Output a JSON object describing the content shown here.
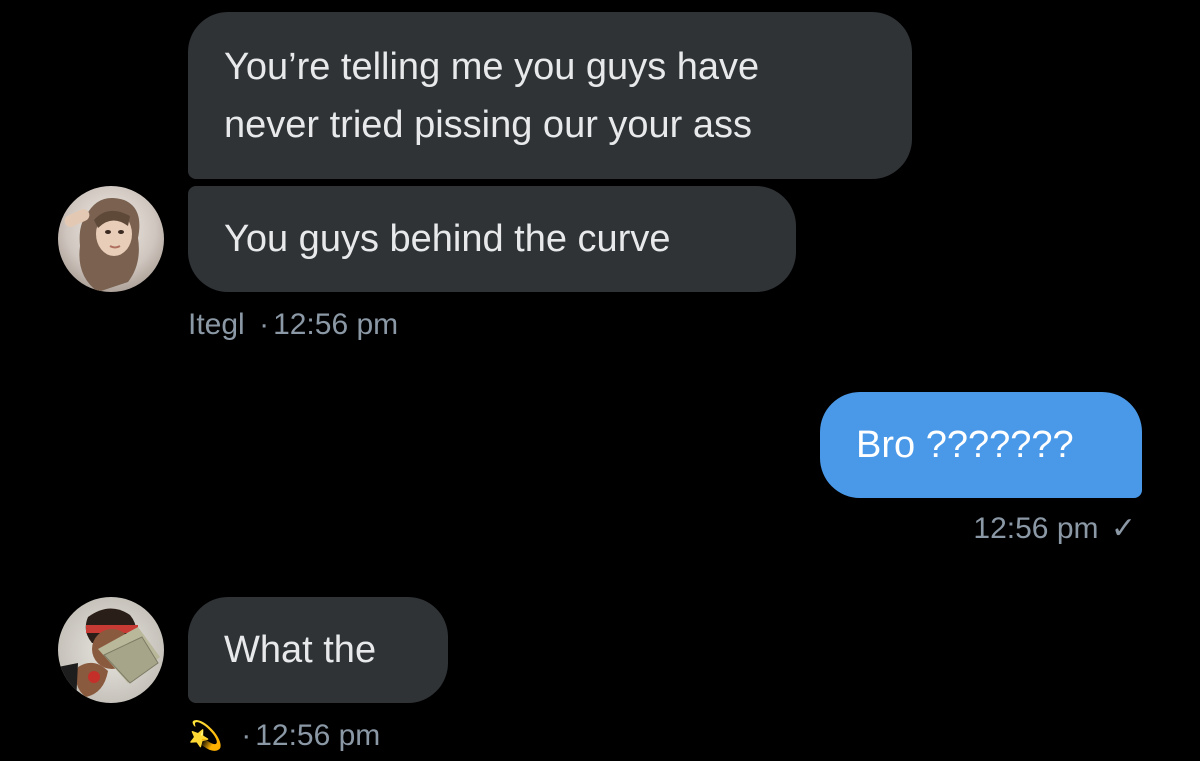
{
  "conversation": {
    "group1": {
      "messages": [
        {
          "text_line1": "You’re telling me you guys have",
          "text_line2": "never tried pissing our your ass"
        },
        {
          "text": "You guys behind the curve"
        }
      ],
      "sender_name": "Itegl",
      "separator": "·",
      "time": "12:56 pm",
      "avatar_icon": "user-avatar-photo"
    },
    "sent": {
      "text": "Bro ???????",
      "time": "12:56 pm",
      "status_icon": "checkmark-icon",
      "status_glyph": "✓"
    },
    "group2": {
      "message": "What the",
      "sender_emoji": "💫",
      "separator": "·",
      "time": "12:56 pm",
      "avatar_icon": "user-avatar-photo"
    }
  },
  "colors": {
    "background": "#000000",
    "received_bubble": "#2f3336",
    "sent_bubble": "#4a99e9",
    "meta_text": "#8b98a5"
  }
}
